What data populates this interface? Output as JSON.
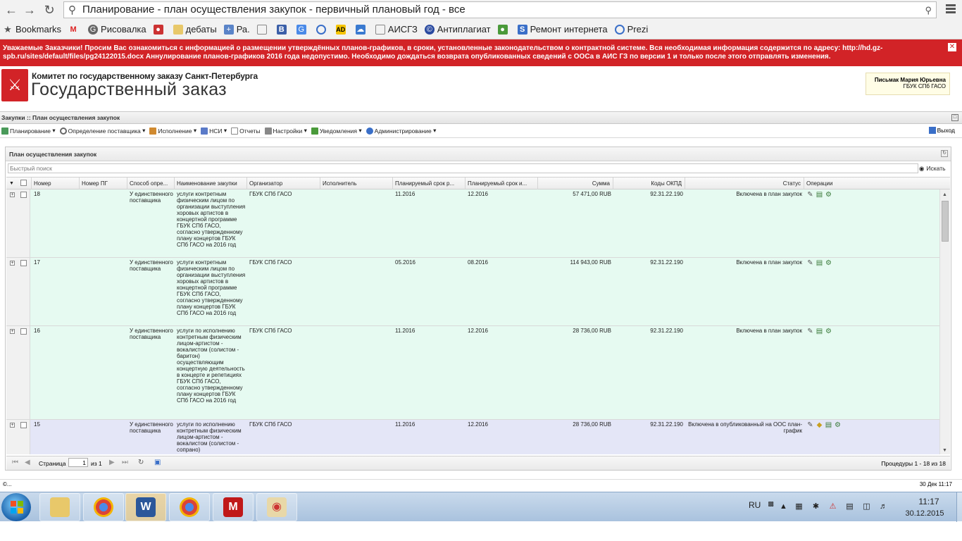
{
  "browser": {
    "address": "Планирование - план осуществления закупок - первичный плановый год - все",
    "bookmarks": [
      "Bookmarks",
      "Рисовалка",
      "дебаты",
      "Ра.",
      "АИСГЗ",
      "Антиплагиат",
      "Ремонт интернета",
      "Prezi"
    ]
  },
  "notice": {
    "text": "Уважаемые Заказчики! Просим Вас ознакомиться с информацией о размещении утверждённых планов-графиков, в сроки, установленные законодательством о контрактной системе. Вся необходимая информация содержится по адресу: http://hd.gz-spb.ru/sites/default/files/pg24122015.docx Аннулирование планов-графиков 2016 года недопустимо. Необходимо дождаться возврата опубликованных сведений с ООСа в АИС ГЗ по версии 1 и только после этого отправлять изменения."
  },
  "header": {
    "org_line1": "Комитет по государственному заказу Санкт-Петербурга",
    "org_line2": "Государственный заказ",
    "user_name": "Письмак Мария Юрьевна",
    "user_org": "ГБУК СПб ГАСО"
  },
  "breadcrumb": "Закупки :: План осуществления закупок",
  "menu": [
    "Планирование",
    "Определение поставщика",
    "Исполнение",
    "НСИ",
    "Отчеты",
    "Настройки",
    "Уведомления",
    "Администрирование"
  ],
  "logout": "Выход",
  "panel": {
    "title": "План осуществления закупок",
    "search_placeholder": "Быстрый поиск",
    "search_button": "Искать"
  },
  "columns": [
    "Номер",
    "Номер ПГ",
    "Способ опре...",
    "Наименование закупки",
    "Организатор",
    "Исполнитель",
    "Планируемый срок р...",
    "Планируемый срок и...",
    "Сумма",
    "Коды ОКПД",
    "Статус",
    "Операции"
  ],
  "rows": [
    {
      "num": "18",
      "method": "У единственного поставщика",
      "name": "услуги контретным физическим лицом по организации выступления хоровых артистов в концертной программе ГБУК СПб ГАСО, согласно утвержденному плану концертов ГБУК СПб ГАСО на 2016 год",
      "org": "ГБУК СПб ГАСО",
      "date1": "11.2016",
      "date2": "12.2016",
      "sum": "57 471,00 RUB",
      "okpd": "92.31.22.190",
      "status": "Включена в план закупок"
    },
    {
      "num": "17",
      "method": "У единственного поставщика",
      "name": "услуги контретным физическим лицом по организации выступления хоровых артистов в концертной программе ГБУК СПб ГАСО, согласно утвержденному плану концертов ГБУК СПб ГАСО на 2016 год",
      "org": "ГБУК СПб ГАСО",
      "date1": "05.2016",
      "date2": "08.2016",
      "sum": "114 943,00 RUB",
      "okpd": "92.31.22.190",
      "status": "Включена в план закупок"
    },
    {
      "num": "16",
      "method": "У единственного поставщика",
      "name": "услуги по исполнению контретным физическим лицом-артистом - вокалистом (солистом - баритон) осуществляющим концертную деятельность в концерте и репетициях ГБУК СПб ГАСО, согласно утвержденному плану концертов ГБУК СПб ГАСО на 2016 год",
      "org": "ГБУК СПб ГАСО",
      "date1": "11.2016",
      "date2": "12.2016",
      "sum": "28 736,00 RUB",
      "okpd": "92.31.22.190",
      "status": "Включена в план закупок"
    },
    {
      "num": "15",
      "method": "У единственного поставщика",
      "name": "услуги по исполнению контретным физическим лицом-артистом - вокалистом (солистом - сопрано) осуществляющим",
      "org": "ГБУК СПб ГАСО",
      "date1": "11.2016",
      "date2": "12.2016",
      "sum": "28 736,00 RUB",
      "okpd": "92.31.22.190",
      "status": "Включена в опубликованный на ООС план-график"
    }
  ],
  "pager": {
    "page_label": "Страница",
    "page_value": "1",
    "page_of": "из 1",
    "summary": "Процедуры 1 - 18 из 18"
  },
  "footer": {
    "left": "©...",
    "date": "30 Дек 11:17"
  },
  "taskbar": {
    "lang": "RU",
    "time": "11:17",
    "date": "30.12.2015"
  },
  "colors": {
    "notice_bg": "#d22327",
    "row_green": "#e6faf1",
    "row_purple": "#e4e6f7"
  }
}
